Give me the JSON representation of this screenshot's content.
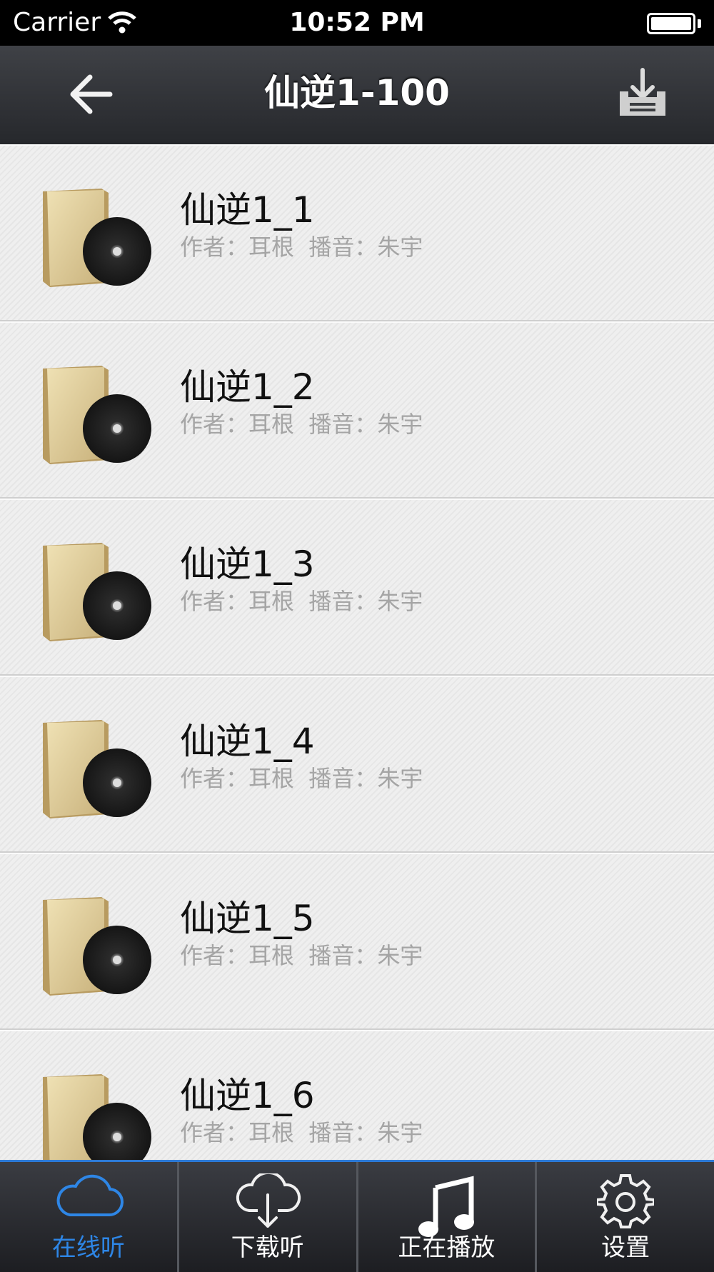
{
  "status_bar": {
    "carrier": "Carrier",
    "time": "10:52 PM"
  },
  "nav": {
    "title": "仙逆1-100",
    "back_icon": "back-arrow-icon",
    "download_icon": "download-tray-icon"
  },
  "list": {
    "items": [
      {
        "title": "仙逆1_1",
        "meta": "作者：耳根  播音：朱宇"
      },
      {
        "title": "仙逆1_2",
        "meta": "作者：耳根  播音：朱宇"
      },
      {
        "title": "仙逆1_3",
        "meta": "作者：耳根  播音：朱宇"
      },
      {
        "title": "仙逆1_4",
        "meta": "作者：耳根  播音：朱宇"
      },
      {
        "title": "仙逆1_5",
        "meta": "作者：耳根  播音：朱宇"
      },
      {
        "title": "仙逆1_6",
        "meta": "作者：耳根  播音：朱宇"
      }
    ]
  },
  "tabs": [
    {
      "label": "在线听",
      "icon": "cloud-icon",
      "active": true
    },
    {
      "label": "下载听",
      "icon": "cloud-download-icon",
      "active": false
    },
    {
      "label": "正在播放",
      "icon": "music-note-icon",
      "active": false
    },
    {
      "label": "设置",
      "icon": "gear-icon",
      "active": false
    }
  ],
  "colors": {
    "accent": "#2e86e6",
    "nav_bg": "#2f3136",
    "meta_text": "#a5a5a5"
  }
}
